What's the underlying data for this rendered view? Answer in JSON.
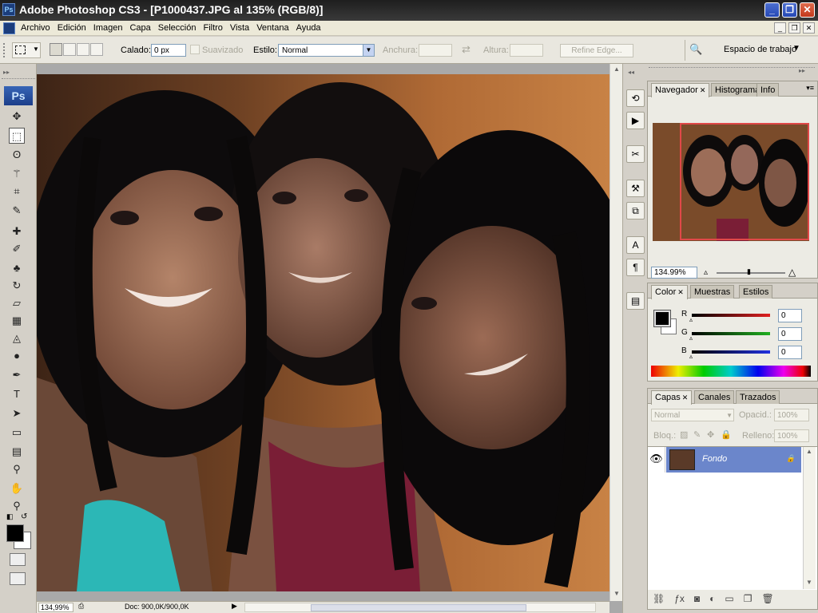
{
  "titlebar": {
    "app_icon": "Ps",
    "title": "Adobe Photoshop CS3 - [P1000437.JPG al 135% (RGB/8)]"
  },
  "window_buttons": {
    "minimize": "_",
    "restore": "❐",
    "close": "✕"
  },
  "menu": {
    "items": [
      "Archivo",
      "Edición",
      "Imagen",
      "Capa",
      "Selección",
      "Filtro",
      "Vista",
      "Ventana",
      "Ayuda"
    ],
    "doc_buttons": [
      "_",
      "❐",
      "✕"
    ]
  },
  "options": {
    "calado_label": "Calado:",
    "calado_value": "0 px",
    "suavizado_label": "Suavizado",
    "estilo_label": "Estilo:",
    "estilo_value": "Normal",
    "anchura_label": "Anchura:",
    "altura_label": "Altura:",
    "refine_edge": "Refine Edge...",
    "workspace_label": "Espacio de trabajo"
  },
  "toolbox": {
    "logo": "Ps",
    "tools": [
      {
        "name": "move-tool",
        "glyph": "✥"
      },
      {
        "name": "marquee-tool",
        "glyph": "⬚"
      },
      {
        "name": "lasso-tool",
        "glyph": "ʘ"
      },
      {
        "name": "magic-wand-tool",
        "glyph": "⚚"
      },
      {
        "name": "crop-tool",
        "glyph": "⌗"
      },
      {
        "name": "slice-tool",
        "glyph": "✎"
      },
      {
        "name": "healing-brush-tool",
        "glyph": "✚"
      },
      {
        "name": "brush-tool",
        "glyph": "✐"
      },
      {
        "name": "clone-stamp-tool",
        "glyph": "♣"
      },
      {
        "name": "history-brush-tool",
        "glyph": "↻"
      },
      {
        "name": "eraser-tool",
        "glyph": "▱"
      },
      {
        "name": "gradient-tool",
        "glyph": "▦"
      },
      {
        "name": "blur-tool",
        "glyph": "◬"
      },
      {
        "name": "dodge-tool",
        "glyph": "●"
      },
      {
        "name": "pen-tool",
        "glyph": "✒"
      },
      {
        "name": "type-tool",
        "glyph": "T"
      },
      {
        "name": "path-selection-tool",
        "glyph": "➤"
      },
      {
        "name": "shape-tool",
        "glyph": "▭"
      },
      {
        "name": "notes-tool",
        "glyph": "▤"
      },
      {
        "name": "eyedropper-tool",
        "glyph": "⚲"
      },
      {
        "name": "hand-tool",
        "glyph": "✋"
      },
      {
        "name": "zoom-tool",
        "glyph": "⚲"
      }
    ]
  },
  "status": {
    "zoom": "134,99%",
    "doc_info": "Doc: 900,0K/900,0K"
  },
  "navigator": {
    "tabs": [
      "Navegador",
      "Histograma",
      "Info"
    ],
    "zoom": "134.99%"
  },
  "color_panel": {
    "tabs": [
      "Color",
      "Muestras",
      "Estilos"
    ],
    "channels": [
      {
        "label": "R",
        "value": "0",
        "color": "#e02020"
      },
      {
        "label": "G",
        "value": "0",
        "color": "#20b020"
      },
      {
        "label": "B",
        "value": "0",
        "color": "#2030e0"
      }
    ],
    "foreground": "#000000",
    "background": "#ffffff"
  },
  "layers_panel": {
    "tabs": [
      "Capas",
      "Canales",
      "Trazados"
    ],
    "blend_mode": "Normal",
    "opacity_label": "Opacid.:",
    "opacity_value": "100%",
    "lock_label": "Bloq.:",
    "fill_label": "Relleno:",
    "fill_value": "100%",
    "layers": [
      {
        "name": "Fondo",
        "visible": true,
        "locked": true
      }
    ]
  }
}
